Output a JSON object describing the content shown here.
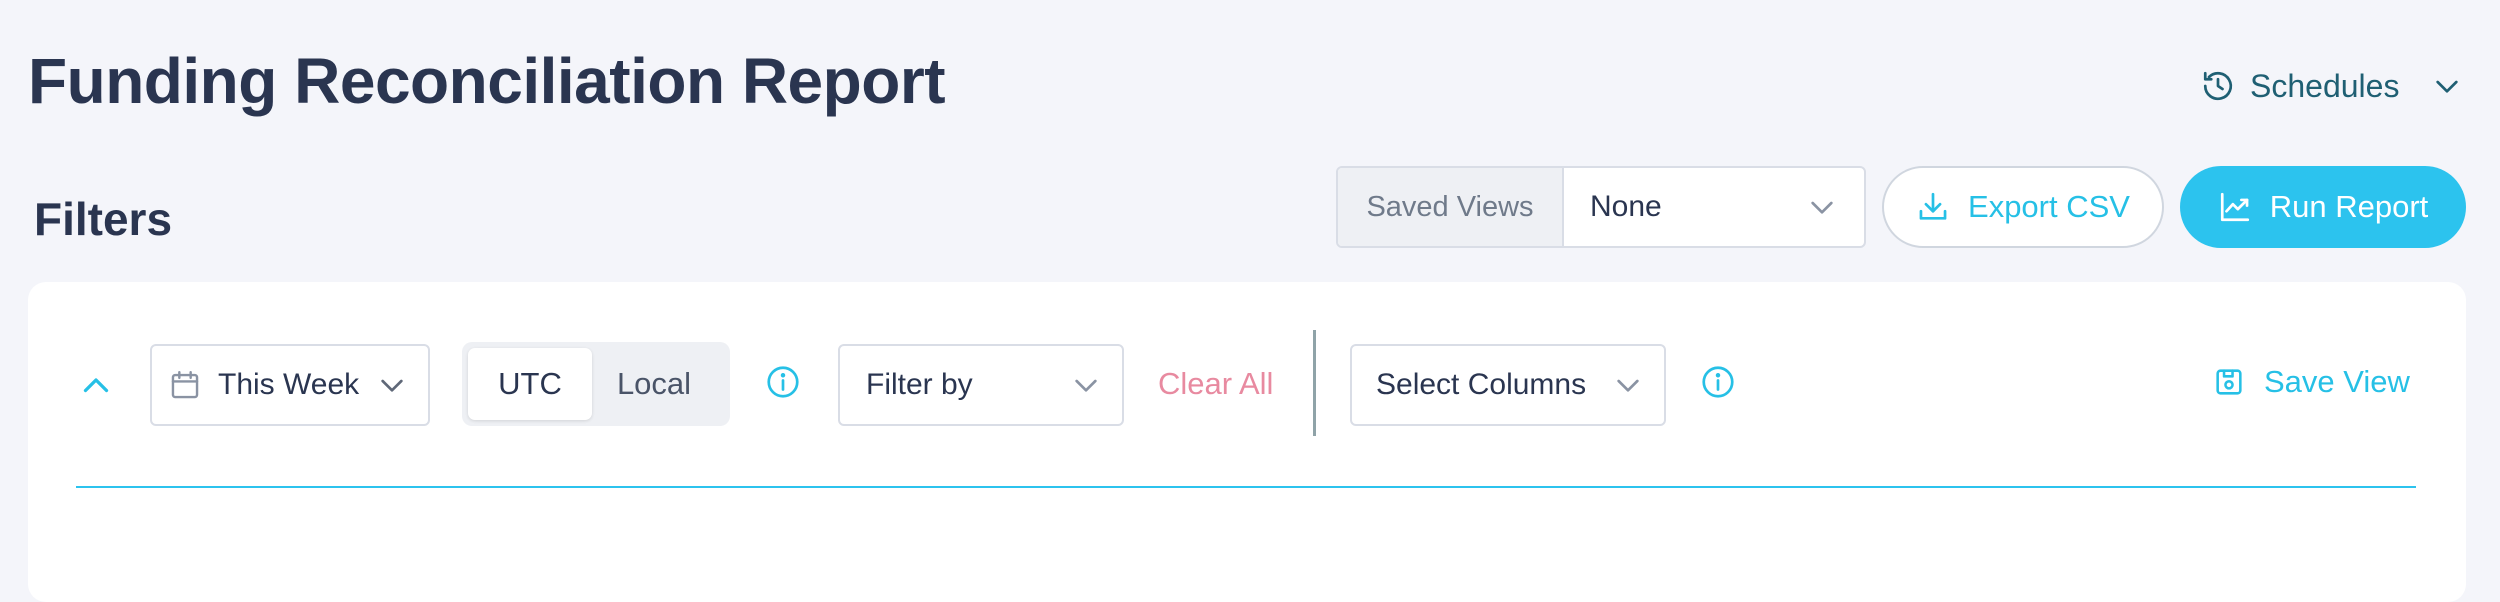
{
  "header": {
    "title": "Funding Reconciliation Report",
    "schedules_label": "Schedules"
  },
  "filters": {
    "heading": "Filters",
    "saved_views_label": "Saved Views",
    "saved_views_value": "None",
    "date_range_value": "This Week",
    "timezone_options": [
      "UTC",
      "Local"
    ],
    "timezone_selected": "UTC",
    "filter_by_label": "Filter by",
    "clear_all_label": "Clear All",
    "select_columns_label": "Select Columns",
    "save_view_label": "Save View"
  },
  "actions": {
    "export_label": "Export CSV",
    "run_label": "Run Report"
  },
  "colors": {
    "accent": "#2cc3ee",
    "text_dark": "#2a3550",
    "clear_all": "#e88aa0",
    "background": "#f4f5fa"
  },
  "icons": {
    "schedules": "history-clock-icon",
    "export": "download-icon",
    "run": "line-chart-icon",
    "date": "calendar-icon",
    "info": "info-circle-icon",
    "save_view": "save-disk-icon",
    "collapse": "chevron-up-icon"
  }
}
